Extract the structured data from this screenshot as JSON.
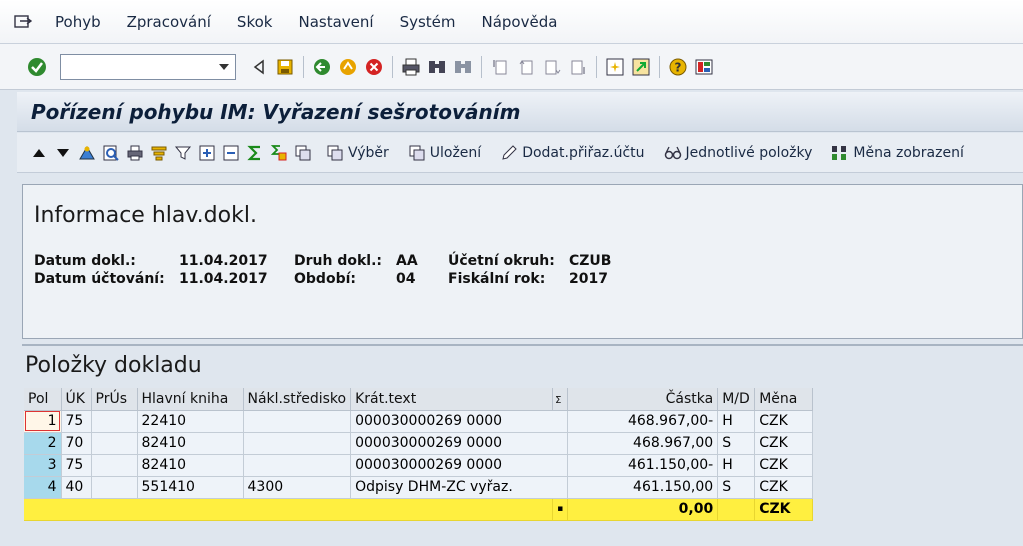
{
  "menu": [
    "Pohyb",
    "Zpracování",
    "Skok",
    "Nastavení",
    "Systém",
    "Nápověda"
  ],
  "title": "Pořízení pohybu IM: Vyřazení sešrotováním",
  "app_toolbar": {
    "vyber": "Výběr",
    "ulozeni": "Uložení",
    "dodat": "Dodat.přiřaz.účtu",
    "jednotlive": "Jednotlivé položky",
    "mena": "Měna zobrazení"
  },
  "header": {
    "title": "Informace hlav.dokl.",
    "datum_dokl_label": "Datum dokl.:",
    "datum_dokl_value": "11.04.2017",
    "datum_uct_label": "Datum účtování:",
    "datum_uct_value": "11.04.2017",
    "druh_label": "Druh dokl.:",
    "druh_value": "AA",
    "obdobi_label": "Období:",
    "obdobi_value": "04",
    "okruh_label": "Účetní okruh:",
    "okruh_value": "CZUB",
    "rok_label": "Fiskální rok:",
    "rok_value": "2017"
  },
  "items": {
    "title": "Položky dokladu",
    "columns": [
      "Pol",
      "ÚK",
      "PrÚs",
      "Hlavní kniha",
      "Nákl.středisko",
      "Krát.text",
      "Σ",
      "Částka",
      "M/D",
      "Měna"
    ],
    "rows": [
      {
        "pol": "1",
        "uk": "75",
        "prus": "",
        "hk": "22410",
        "ns": "",
        "text": "000030000269 0000",
        "castka": "468.967,00-",
        "md": "H",
        "mena": "CZK"
      },
      {
        "pol": "2",
        "uk": "70",
        "prus": "",
        "hk": "82410",
        "ns": "",
        "text": "000030000269 0000",
        "castka": "468.967,00",
        "md": "S",
        "mena": "CZK"
      },
      {
        "pol": "3",
        "uk": "75",
        "prus": "",
        "hk": "82410",
        "ns": "",
        "text": "000030000269 0000",
        "castka": "461.150,00-",
        "md": "H",
        "mena": "CZK"
      },
      {
        "pol": "4",
        "uk": "40",
        "prus": "",
        "hk": "551410",
        "ns": "4300",
        "text": "Odpisy DHM-ZC vyřaz.",
        "castka": "461.150,00",
        "md": "S",
        "mena": "CZK"
      }
    ],
    "total": {
      "marker": "▪",
      "castka": "0,00",
      "mena": "CZK"
    }
  },
  "colors": {
    "title_bar": "#d4dde8",
    "total_row": "#ffef40",
    "pol_cell": "#a7d9ec"
  }
}
